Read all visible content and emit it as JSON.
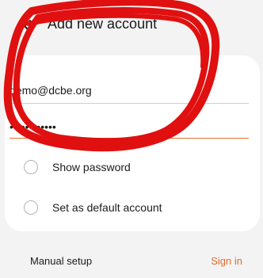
{
  "header": {
    "title": "Add new account",
    "back_icon": "back-arrow-icon"
  },
  "form": {
    "email_value": "demo@dcbe.org",
    "password_value": "••••••••••••",
    "show_password_label": "Show password",
    "show_password_checked": false,
    "default_account_label": "Set as default account",
    "default_account_checked": false
  },
  "footer": {
    "manual_setup_label": "Manual setup",
    "sign_in_label": "Sign in"
  },
  "colors": {
    "accent": "#e26a2c",
    "background": "#f3f3f3",
    "card": "#ffffff",
    "annotation": "#e01010"
  }
}
